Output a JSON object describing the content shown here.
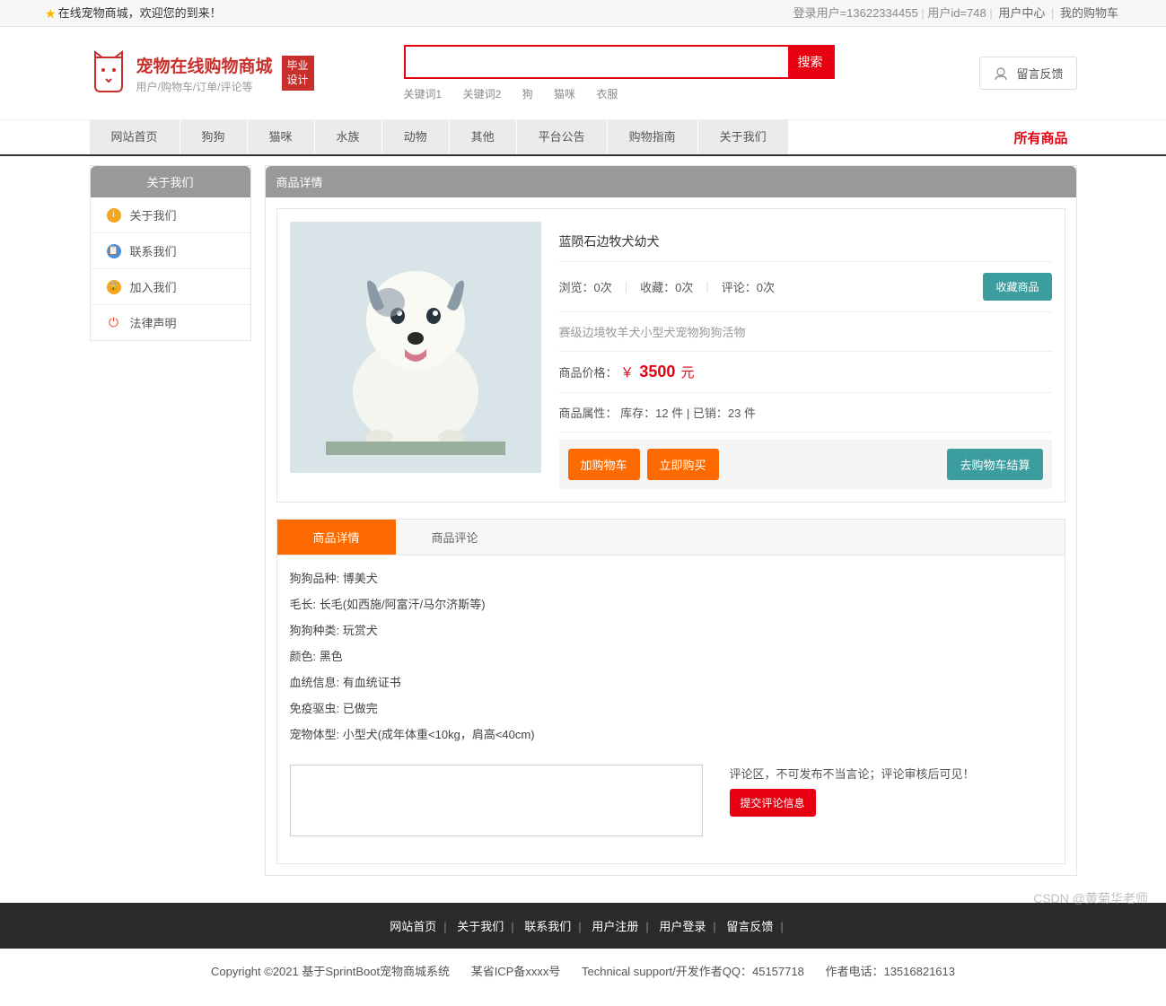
{
  "topbar": {
    "welcome": "在线宠物商城，欢迎您的到来！",
    "login_user_label": "登录用户=13622334455",
    "user_id_label": "用户id=748",
    "user_center": "用户中心",
    "my_cart": "我的购物车"
  },
  "header": {
    "logo_title": "宠物在线购物商城",
    "logo_sub": "用户/购物车/订单/评论等",
    "badge_line1": "毕业",
    "badge_line2": "设计",
    "search_btn": "搜索",
    "keywords": [
      "关键词1",
      "关键词2",
      "狗",
      "猫咪",
      "衣服"
    ],
    "feedback": "留言反馈"
  },
  "nav": {
    "items": [
      "网站首页",
      "狗狗",
      "猫咪",
      "水族",
      "动物",
      "其他",
      "平台公告",
      "购物指南",
      "关于我们"
    ],
    "right": "所有商品"
  },
  "sidebar": {
    "title": "关于我们",
    "items": [
      {
        "label": "关于我们"
      },
      {
        "label": "联系我们"
      },
      {
        "label": "加入我们"
      },
      {
        "label": "法律声明"
      }
    ]
  },
  "content": {
    "header": "商品详情",
    "product": {
      "title": "蓝陨石边牧犬幼犬",
      "views_label": "浏览：0次",
      "favs_label": "收藏：0次",
      "comments_label": "评论：0次",
      "fav_btn": "收藏商品",
      "desc": "赛级边境牧羊犬小型犬宠物狗狗活物",
      "price_label": "商品价格：",
      "price_symbol": "￥",
      "price_value": "3500",
      "price_unit": "元",
      "attr_label": "商品属性：",
      "stock": "库存：12 件",
      "sold": "已销：23 件",
      "add_cart": "加购物车",
      "buy_now": "立即购买",
      "go_checkout": "去购物车结算"
    },
    "tabs": {
      "detail": "商品详情",
      "comment": "商品评论"
    },
    "details": [
      "狗狗品种: 博美犬",
      "毛长: 长毛(如西施/阿富汗/马尔济斯等)",
      "狗狗种类: 玩赏犬",
      "颜色: 黑色",
      "血统信息: 有血统证书",
      "免疫驱虫: 已做完",
      "宠物体型: 小型犬(成年体重<10kg，肩高<40cm)"
    ],
    "comment_tip": "评论区，不可发布不当言论；评论审核后可见！",
    "submit_btn": "提交评论信息"
  },
  "footer": {
    "links": [
      "网站首页",
      "关于我们",
      "联系我们",
      "用户注册",
      "用户登录",
      "留言反馈"
    ],
    "copyright": "Copyright ©2021 基于SprintBoot宠物商城系统",
    "icp": "某省ICP备xxxx号",
    "qq": "Technical support/开发作者QQ：45157718",
    "phone": "作者电话：13516821613"
  },
  "watermark": "CSDN @黄菊华老师"
}
